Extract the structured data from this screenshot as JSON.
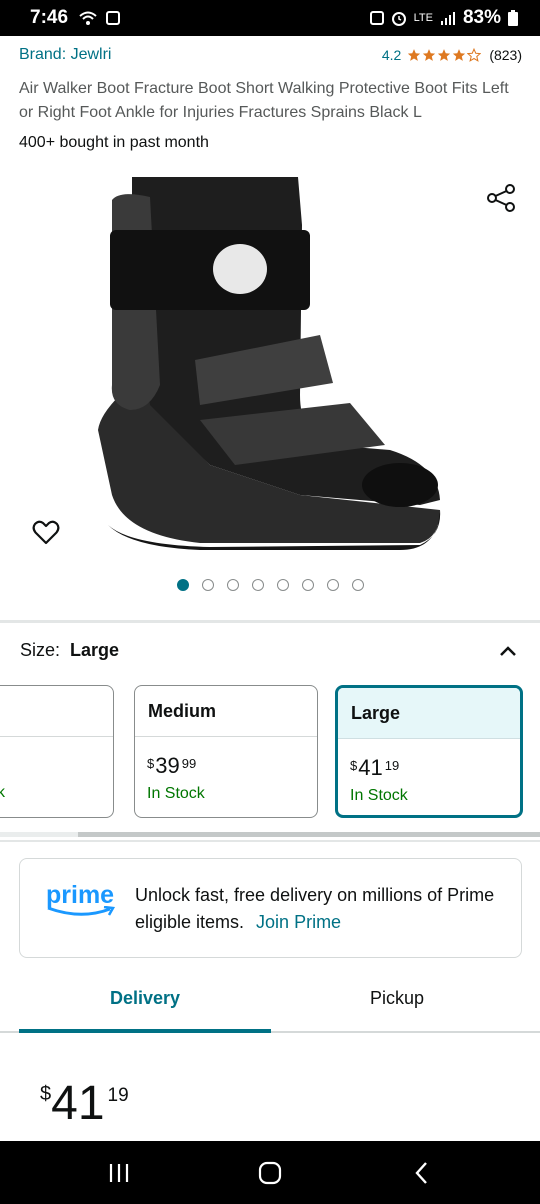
{
  "status_bar": {
    "time": "7:46",
    "network": "LTE",
    "battery": "83%"
  },
  "product": {
    "brand": "Brand: Jewlri",
    "rating": "4.2",
    "rating_count": "(823)",
    "title": "Air Walker Boot Fracture Boot Short Walking Protective Boot Fits Left or Right Foot Ankle for Injuries Fractures Sprains Black L",
    "bought": "400+ bought in past month",
    "image_pages": 8,
    "image_active_page": 1
  },
  "size": {
    "label": "Size:",
    "value": "Large",
    "partial_card_stock": "k",
    "options": [
      {
        "name": "Medium",
        "symbol": "$",
        "whole": "39",
        "cents": "99",
        "stock": "In Stock"
      },
      {
        "name": "Large",
        "symbol": "$",
        "whole": "41",
        "cents": "19",
        "stock": "In Stock"
      }
    ]
  },
  "prime": {
    "logo": "prime",
    "text": "Unlock fast, free delivery on millions of Prime eligible items.",
    "link": "Join Prime"
  },
  "tabs": {
    "delivery": "Delivery",
    "pickup": "Pickup"
  },
  "price": {
    "symbol": "$",
    "whole": "41",
    "cents": "19"
  },
  "colors": {
    "accent": "#007185",
    "in_stock": "#007600",
    "star": "#de7921",
    "prime": "#1a98ff"
  }
}
